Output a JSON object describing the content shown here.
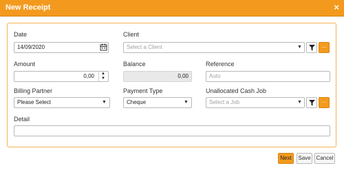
{
  "window": {
    "title": "New Receipt",
    "close_glyph": "×"
  },
  "fields": {
    "date": {
      "label": "Date",
      "value": "14/09/2020"
    },
    "client": {
      "label": "Client",
      "placeholder": "Select a Client"
    },
    "amount": {
      "label": "Amount",
      "value": "0,00"
    },
    "balance": {
      "label": "Balance",
      "value": "0,00"
    },
    "reference": {
      "label": "Reference",
      "placeholder": "Auto"
    },
    "billing_partner": {
      "label": "Billing Partner",
      "value": "Please Select"
    },
    "payment_type": {
      "label": "Payment Type",
      "value": "Cheque"
    },
    "unallocated_cash_job": {
      "label": "Unallocated Cash Job",
      "placeholder": "Select a Job"
    },
    "detail": {
      "label": "Detail",
      "value": ""
    }
  },
  "lookup_button_label": "...",
  "buttons": {
    "next": "Next",
    "save": "Save",
    "cancel": "Cancel"
  },
  "colors": {
    "accent": "#f39a1e",
    "panel_border": "#f3b256"
  },
  "icons": [
    "close-icon",
    "calendar-icon",
    "chevron-down-icon",
    "filter-icon",
    "spinner-up-icon",
    "spinner-down-icon"
  ]
}
